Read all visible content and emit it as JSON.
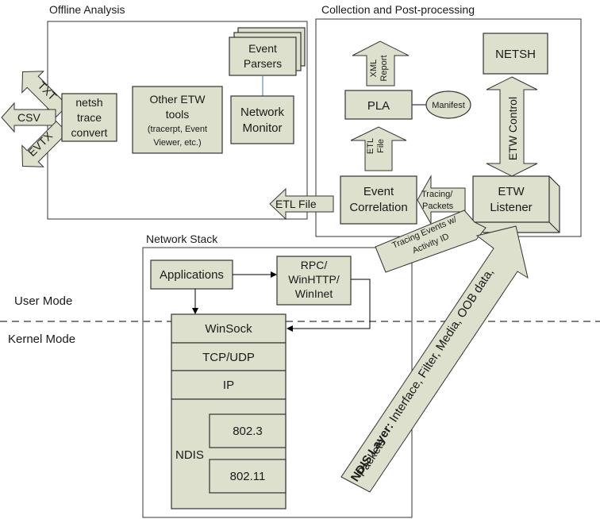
{
  "sections": {
    "offline": "Offline Analysis",
    "collection": "Collection and Post-processing",
    "network_stack": "Network Stack"
  },
  "modes": {
    "user": "User Mode",
    "kernel": "Kernel Mode"
  },
  "offline": {
    "netsh_convert": [
      "netsh",
      "trace",
      "convert"
    ],
    "other_tools": [
      "Other ETW",
      "tools"
    ],
    "other_tools_note": [
      "(tracerpt, Event",
      "Viewer, etc.)"
    ],
    "event_parsers": [
      "Event",
      "Parsers"
    ],
    "network_monitor": [
      "Network",
      "Monitor"
    ],
    "outputs": [
      "TXT",
      "CSV",
      "EVTX"
    ]
  },
  "collection": {
    "netsh": "NETSH",
    "pla": "PLA",
    "manifest": "Manifest",
    "xml_report": [
      "XML",
      "Report"
    ],
    "etl_file_up": [
      "ETL",
      "File"
    ],
    "etw_control": "ETW Control",
    "event_correlation": [
      "Event",
      "Correlation"
    ],
    "tracing_packets": [
      "Tracing/",
      "Packets"
    ],
    "etw_listener": [
      "ETW",
      "Listener"
    ]
  },
  "etl_file_out": "ETL File",
  "stack": {
    "applications": "Applications",
    "rpc": [
      "RPC/",
      "WinHTTP/",
      "WinInet"
    ],
    "winsock": "WinSock",
    "tcpudp": "TCP/UDP",
    "ip": "IP",
    "ndis": "NDIS",
    "ieee8023": "802.3",
    "ieee80211": "802.11"
  },
  "tracing_events": [
    "Tracing Events w/",
    "Activity ID"
  ],
  "ndis_arrow": {
    "bold": "NDIS Layer:",
    "rest": " Interface, Filter, Media, OOB data,",
    "line2": "Packets"
  }
}
